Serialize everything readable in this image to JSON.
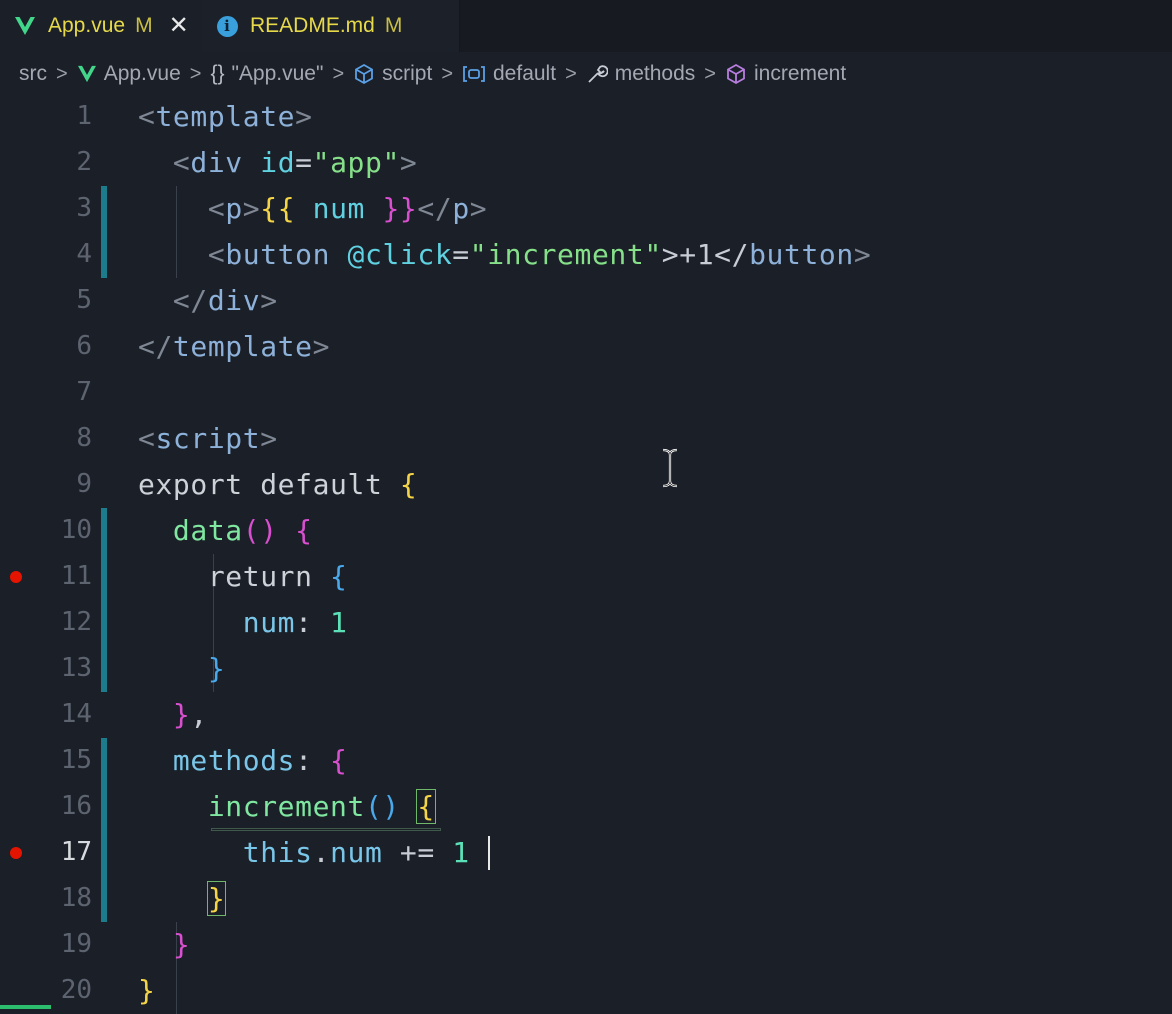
{
  "tabs": [
    {
      "label": "App.vue",
      "modified": "M",
      "icon": "vue-icon"
    },
    {
      "label": "README.md",
      "modified": "M",
      "icon": "info-icon"
    }
  ],
  "breadcrumb": [
    {
      "label": "src",
      "icon": ""
    },
    {
      "label": "App.vue",
      "icon": "vue-icon"
    },
    {
      "label": "\"App.vue\"",
      "icon": "braces-icon"
    },
    {
      "label": "script",
      "icon": "cube-icon"
    },
    {
      "label": "default",
      "icon": "variable-icon"
    },
    {
      "label": "methods",
      "icon": "wrench-icon"
    },
    {
      "label": "increment",
      "icon": "method-cube-icon"
    }
  ],
  "line_numbers": [
    "1",
    "2",
    "3",
    "4",
    "5",
    "6",
    "7",
    "8",
    "9",
    "10",
    "11",
    "12",
    "13",
    "14",
    "15",
    "16",
    "17",
    "18",
    "19",
    "20"
  ],
  "code": {
    "l1": [
      "<",
      "template",
      ">"
    ],
    "l2": [
      "<",
      "div",
      " ",
      "id",
      "=",
      "\"app\"",
      ">"
    ],
    "l3": [
      "<",
      "p",
      ">",
      "{{",
      " num ",
      "}}",
      "</",
      "p",
      ">"
    ],
    "l4": [
      "<",
      "button",
      " ",
      "@click",
      "=",
      "\"increment\"",
      ">+1</",
      "button",
      ">"
    ],
    "l5": [
      "</",
      "div",
      ">"
    ],
    "l6": [
      "</",
      "template",
      ">"
    ],
    "l8": [
      "<",
      "script",
      ">"
    ],
    "l9": [
      "export default ",
      "{"
    ],
    "l10": [
      "data",
      "()",
      " ",
      "{"
    ],
    "l11": [
      "return ",
      "{"
    ],
    "l12": [
      "num",
      ": ",
      "1"
    ],
    "l13": [
      "}"
    ],
    "l14": [
      "}",
      ","
    ],
    "l15": [
      "methods",
      ": ",
      "{"
    ],
    "l16": [
      "increment",
      "()",
      " ",
      "{"
    ],
    "l17": [
      "this",
      ".",
      "num",
      " += ",
      "1"
    ],
    "l18": [
      "}"
    ],
    "l19": [
      "}"
    ],
    "l20": [
      "}"
    ]
  },
  "breakpoint_lines": [
    "11",
    "17"
  ],
  "active_line": "17",
  "colors": {
    "tab_label": "#e6d94a",
    "breakpoint": "#e51400",
    "modified_gutter": "#1d7c8c",
    "vue_green": "#41d68a"
  }
}
